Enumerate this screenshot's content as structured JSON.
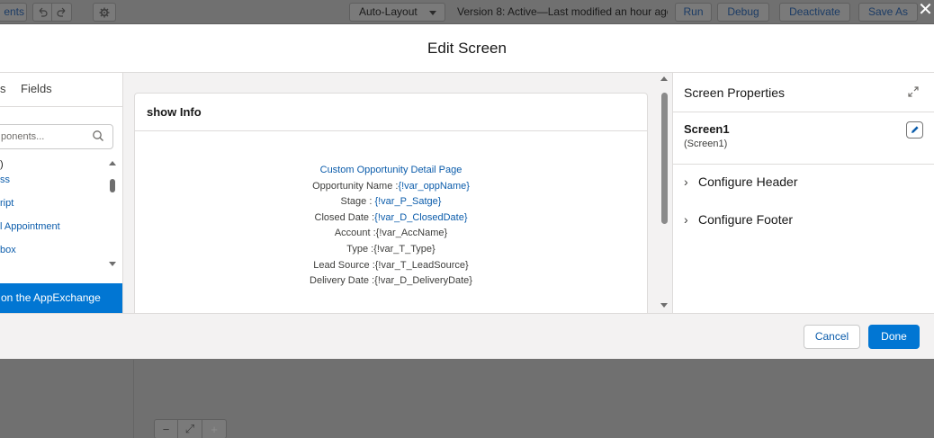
{
  "toolbar": {
    "left_button": "ents",
    "undo_icon": "undo-icon",
    "redo_icon": "redo-icon",
    "settings_icon": "gear-icon",
    "layout_select": "Auto-Layout",
    "status": "Version 8: Active—Last modified an hour ago",
    "run": "Run",
    "debug": "Debug",
    "deactivate": "Deactivate",
    "save_as": "Save As",
    "close": "✕"
  },
  "modal": {
    "title": "Edit Screen"
  },
  "left_panel": {
    "tab_partial": "s",
    "tab_fields": "Fields",
    "search_placeholder": "ponents...",
    "list_header": ")",
    "items": [
      "ss",
      "ript",
      "l Appointment",
      "box"
    ],
    "appexchange": "on the AppExchange"
  },
  "canvas": {
    "screen_title": "show Info",
    "lines": [
      {
        "label": "Custom Opportunity Detail Page",
        "value": ""
      },
      {
        "label": "Opportunity Name :",
        "value": "{!var_oppName}"
      },
      {
        "label": "Stage : ",
        "value": "{!var_P_Satge}"
      },
      {
        "label": "Closed Date :",
        "value": "{!var_D_ClosedDate}"
      },
      {
        "label": "Account :{!var_AccName}",
        "value": ""
      },
      {
        "label": "Type :{!var_T_Type}",
        "value": ""
      },
      {
        "label": "Lead Source :{!var_T_LeadSource}",
        "value": ""
      },
      {
        "label": "Delivery Date :{!var_D_DeliveryDate}",
        "value": ""
      }
    ]
  },
  "right_panel": {
    "title": "Screen Properties",
    "screen_name": "Screen1",
    "screen_api": "(Screen1)",
    "sections": [
      "Configure Header",
      "Configure Footer"
    ]
  },
  "footer": {
    "cancel": "Cancel",
    "done": "Done"
  },
  "zoom": {
    "zoom_out": "−",
    "fit": "⤢",
    "zoom_in": "+"
  },
  "colors": {
    "brand": "#0176d3",
    "link": "#0b5cab"
  }
}
